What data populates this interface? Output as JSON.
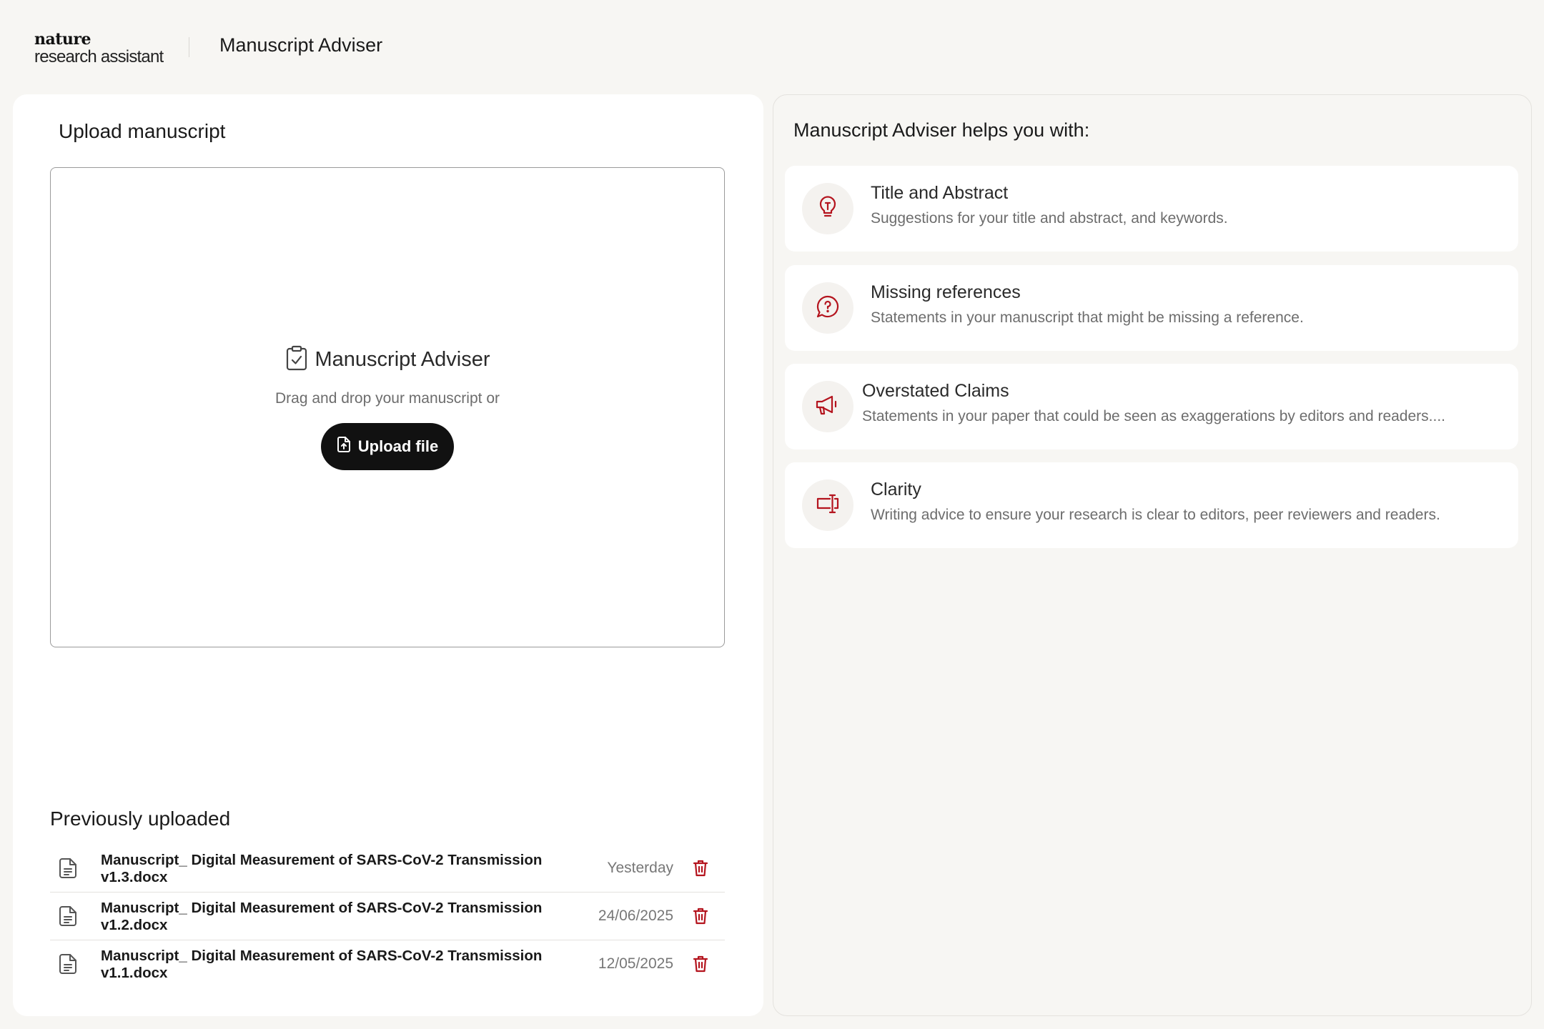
{
  "header": {
    "logo_top": "nature",
    "logo_bottom": "research assistant",
    "title": "Manuscript Adviser"
  },
  "upload": {
    "heading": "Upload manuscript",
    "dropzone_title": "Manuscript Adviser",
    "dropzone_subtitle": "Drag and drop your manuscript or",
    "button_label": "Upload file"
  },
  "previous": {
    "heading": "Previously uploaded",
    "files": [
      {
        "name": "Manuscript_ Digital Measurement of SARS-CoV-2 Transmission v1.3.docx",
        "date": "Yesterday"
      },
      {
        "name": "Manuscript_ Digital Measurement of SARS-CoV-2 Transmission v1.2.docx",
        "date": "24/06/2025"
      },
      {
        "name": "Manuscript_ Digital Measurement of SARS-CoV-2 Transmission v1.1.docx",
        "date": "12/05/2025"
      }
    ]
  },
  "helps": {
    "heading": "Manuscript Adviser helps you with:",
    "features": [
      {
        "icon": "lightbulb-icon",
        "title": "Title and Abstract",
        "description": "Suggestions for your title and abstract, and keywords."
      },
      {
        "icon": "question-bubble-icon",
        "title": "Missing references",
        "description": "Statements in your manuscript that might be missing a reference."
      },
      {
        "icon": "megaphone-icon",
        "title": "Overstated Claims",
        "description": "Statements in your paper that could be seen as exaggerations by editors and readers...."
      },
      {
        "icon": "text-cursor-icon",
        "title": "Clarity",
        "description": "Writing advice to ensure your research is clear to editors, peer reviewers and readers."
      }
    ]
  },
  "colors": {
    "accent_red": "#b4141e",
    "button_bg": "#111111",
    "page_bg": "#f7f6f3"
  }
}
